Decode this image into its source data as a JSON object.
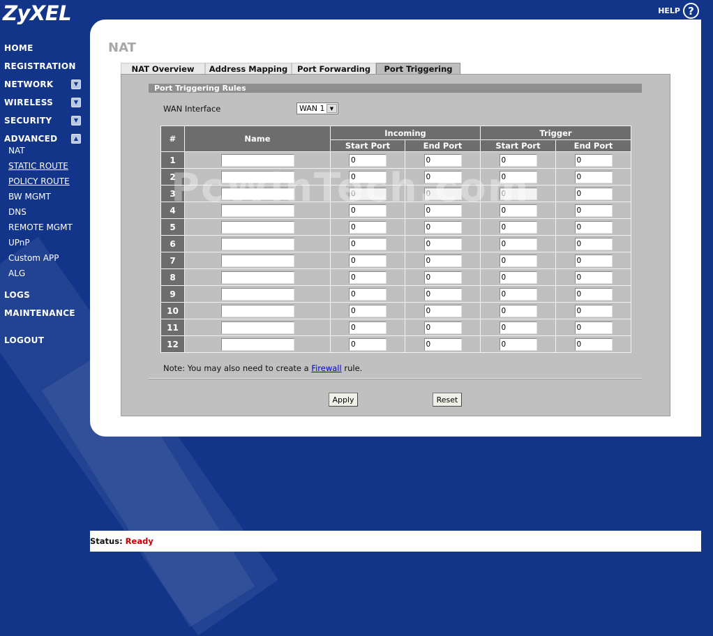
{
  "brand": "ZyXEL",
  "help": {
    "label": "HELP",
    "icon": "?"
  },
  "nav": {
    "home": "HOME",
    "registration": "REGISTRATION",
    "network": "NETWORK",
    "wireless": "WIRELESS",
    "security": "SECURITY",
    "advanced": "ADVANCED",
    "advanced_items": [
      "NAT",
      "STATIC ROUTE",
      "POLICY ROUTE",
      "BW MGMT",
      "DNS",
      "REMOTE MGMT",
      "UPnP",
      "Custom APP",
      "ALG"
    ],
    "logs": "LOGS",
    "maintenance": "MAINTENANCE",
    "logout": "LOGOUT"
  },
  "page": {
    "title": "NAT"
  },
  "tabs": [
    "NAT Overview",
    "Address Mapping",
    "Port Forwarding",
    "Port Triggering"
  ],
  "active_tab": "Port Triggering",
  "section": {
    "title": "Port Triggering Rules"
  },
  "wan": {
    "label": "WAN Interface",
    "value": "WAN 1"
  },
  "table": {
    "headers": {
      "num": "#",
      "name": "Name",
      "incoming": "Incoming",
      "trigger": "Trigger",
      "start_port": "Start Port",
      "end_port": "End Port"
    },
    "rows": [
      {
        "num": "1",
        "name": "",
        "in_start": "0",
        "in_end": "0",
        "tr_start": "0",
        "tr_end": "0"
      },
      {
        "num": "2",
        "name": "",
        "in_start": "0",
        "in_end": "0",
        "tr_start": "0",
        "tr_end": "0"
      },
      {
        "num": "3",
        "name": "",
        "in_start": "0",
        "in_end": "0",
        "tr_start": "0",
        "tr_end": "0"
      },
      {
        "num": "4",
        "name": "",
        "in_start": "0",
        "in_end": "0",
        "tr_start": "0",
        "tr_end": "0"
      },
      {
        "num": "5",
        "name": "",
        "in_start": "0",
        "in_end": "0",
        "tr_start": "0",
        "tr_end": "0"
      },
      {
        "num": "6",
        "name": "",
        "in_start": "0",
        "in_end": "0",
        "tr_start": "0",
        "tr_end": "0"
      },
      {
        "num": "7",
        "name": "",
        "in_start": "0",
        "in_end": "0",
        "tr_start": "0",
        "tr_end": "0"
      },
      {
        "num": "8",
        "name": "",
        "in_start": "0",
        "in_end": "0",
        "tr_start": "0",
        "tr_end": "0"
      },
      {
        "num": "9",
        "name": "",
        "in_start": "0",
        "in_end": "0",
        "tr_start": "0",
        "tr_end": "0"
      },
      {
        "num": "10",
        "name": "",
        "in_start": "0",
        "in_end": "0",
        "tr_start": "0",
        "tr_end": "0"
      },
      {
        "num": "11",
        "name": "",
        "in_start": "0",
        "in_end": "0",
        "tr_start": "0",
        "tr_end": "0"
      },
      {
        "num": "12",
        "name": "",
        "in_start": "0",
        "in_end": "0",
        "tr_start": "0",
        "tr_end": "0"
      }
    ]
  },
  "note": {
    "prefix": "Note: You may also need to create a ",
    "link": "Firewall",
    "suffix": " rule."
  },
  "buttons": {
    "apply": "Apply",
    "reset": "Reset"
  },
  "watermark": "PcWinTech.com",
  "status": {
    "label": "Status:",
    "value": "Ready"
  }
}
